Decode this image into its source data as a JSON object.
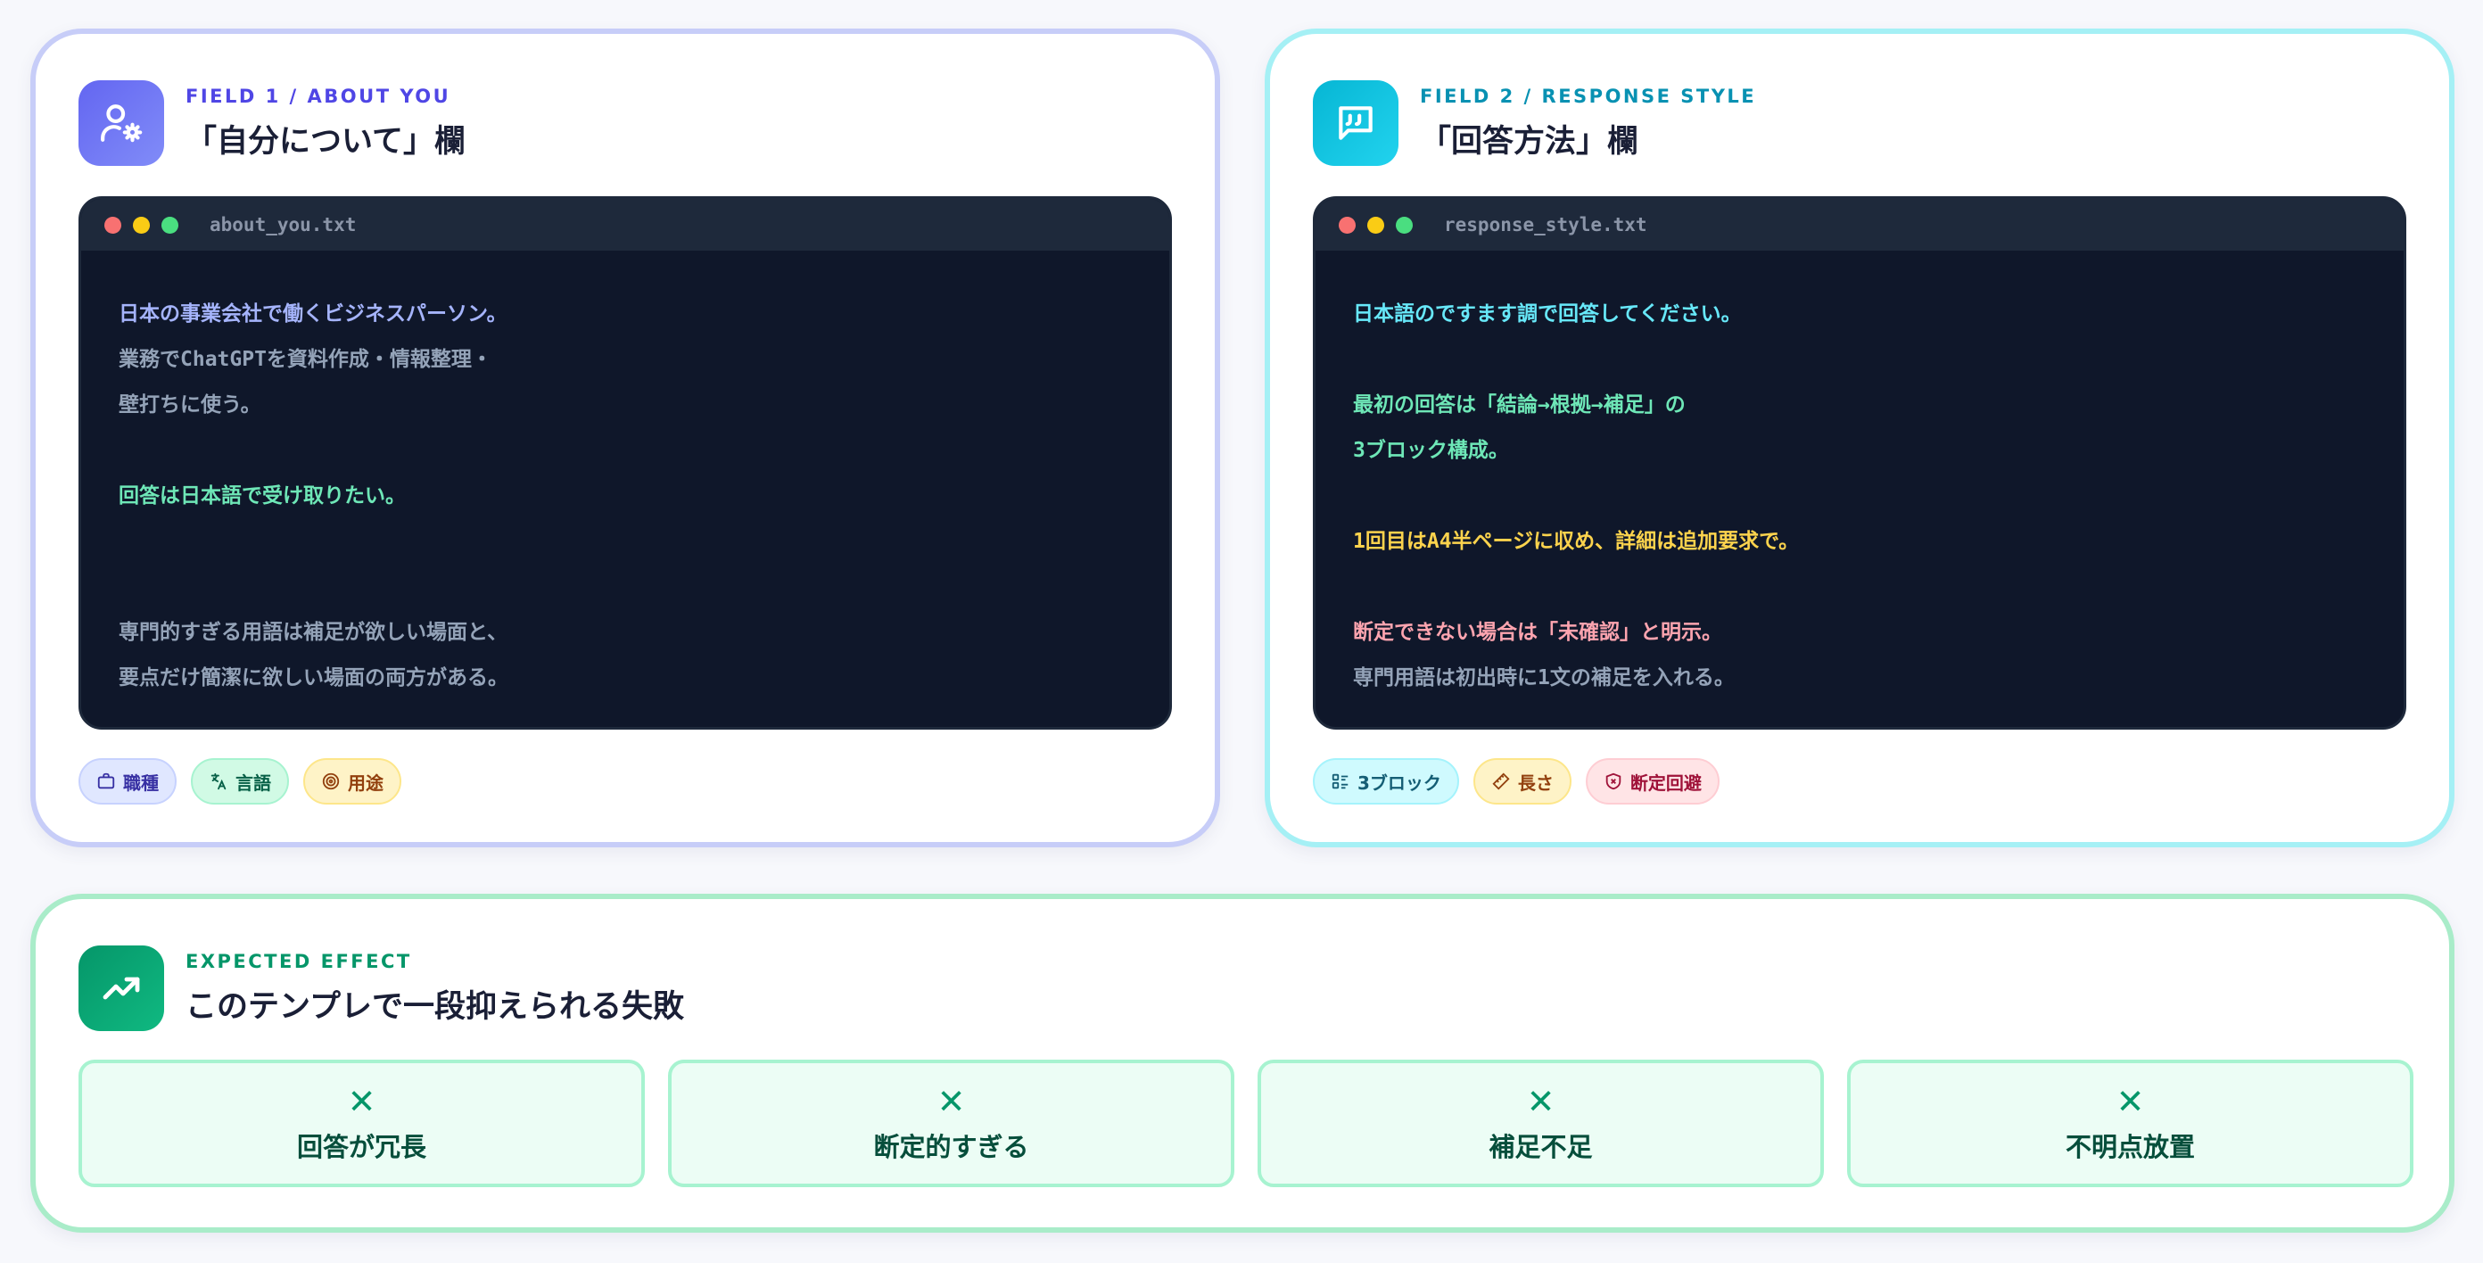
{
  "colors": {
    "indigo": "#6366f1",
    "cyan": "#06b6d4",
    "green": "#10b981",
    "terminal_bg": "#0f172a"
  },
  "field1": {
    "eyebrow": "FIELD 1 / ABOUT YOU",
    "title": "「自分について」欄",
    "icon": "user-gear-icon",
    "filename": "about_you.txt",
    "lines": [
      "日本の事業会社で働くビジネスパーソン。",
      "業務でChatGPTを資料作成・情報整理・",
      "壁打ちに使う。",
      "",
      "回答は日本語で受け取りたい。",
      "",
      "",
      "専門的すぎる用語は補足が欲しい場面と、",
      "要点だけ簡潔に欲しい場面の両方がある。"
    ],
    "tags": [
      {
        "label": "職種",
        "icon": "briefcase-icon"
      },
      {
        "label": "言語",
        "icon": "translate-icon"
      },
      {
        "label": "用途",
        "icon": "target-icon"
      }
    ]
  },
  "field2": {
    "eyebrow": "FIELD 2 / RESPONSE STYLE",
    "title": "「回答方法」欄",
    "icon": "chat-quote-icon",
    "filename": "response_style.txt",
    "lines": [
      "日本語のですます調で回答してください。",
      "",
      "最初の回答は「結論→根拠→補足」の",
      "3ブロック構成。",
      "",
      "1回目はA4半ページに収め、詳細は追加要求で。",
      "",
      "断定できない場合は「未確認」と明示。",
      "専門用語は初出時に1文の補足を入れる。"
    ],
    "tags": [
      {
        "label": "3ブロック",
        "icon": "list-blocks-icon"
      },
      {
        "label": "長さ",
        "icon": "ruler-icon"
      },
      {
        "label": "断定回避",
        "icon": "shield-icon"
      }
    ]
  },
  "effect": {
    "eyebrow": "EXPECTED EFFECT",
    "title": "このテンプレで一段抑えられる失敗",
    "icon": "trending-up-icon",
    "mark": "✕",
    "items": [
      "回答が冗長",
      "断定的すぎる",
      "補足不足",
      "不明点放置"
    ]
  }
}
